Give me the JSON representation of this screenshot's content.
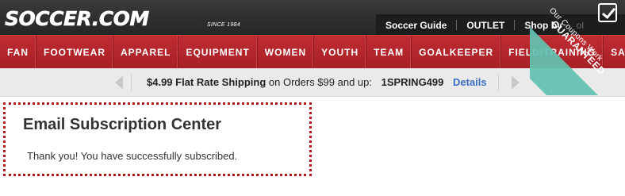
{
  "header": {
    "logo_text": "SOCCER.COM",
    "logo_tagline": "SINCE 1984",
    "util_links": [
      "Soccer Guide",
      "OUTLET",
      "Shop by"
    ],
    "util_extra": "ol"
  },
  "category_nav": {
    "items": [
      "FAN",
      "FOOTWEAR",
      "APPAREL",
      "EQUIPMENT",
      "WOMEN",
      "YOUTH",
      "TEAM",
      "GOALKEEPER",
      "FIELD/TRAINING",
      "SALE"
    ]
  },
  "promo": {
    "price": "$4.99 Flat Rate Shipping",
    "condition": "on Orders $99 and up:",
    "code": "1SPRING499",
    "details_label": "Details"
  },
  "badge": {
    "line1": "Our Coupons Work",
    "line2": "GUARANTEED",
    "color": "#62c2b0",
    "icon": "checkmark-box-icon"
  },
  "subscription": {
    "title": "Email Subscription Center",
    "message": "Thank you! You have successfully subscribed."
  },
  "colors": {
    "nav_red": "#b5252a",
    "header_dark": "#2c2c2c",
    "link_blue": "#3a6fc4"
  }
}
